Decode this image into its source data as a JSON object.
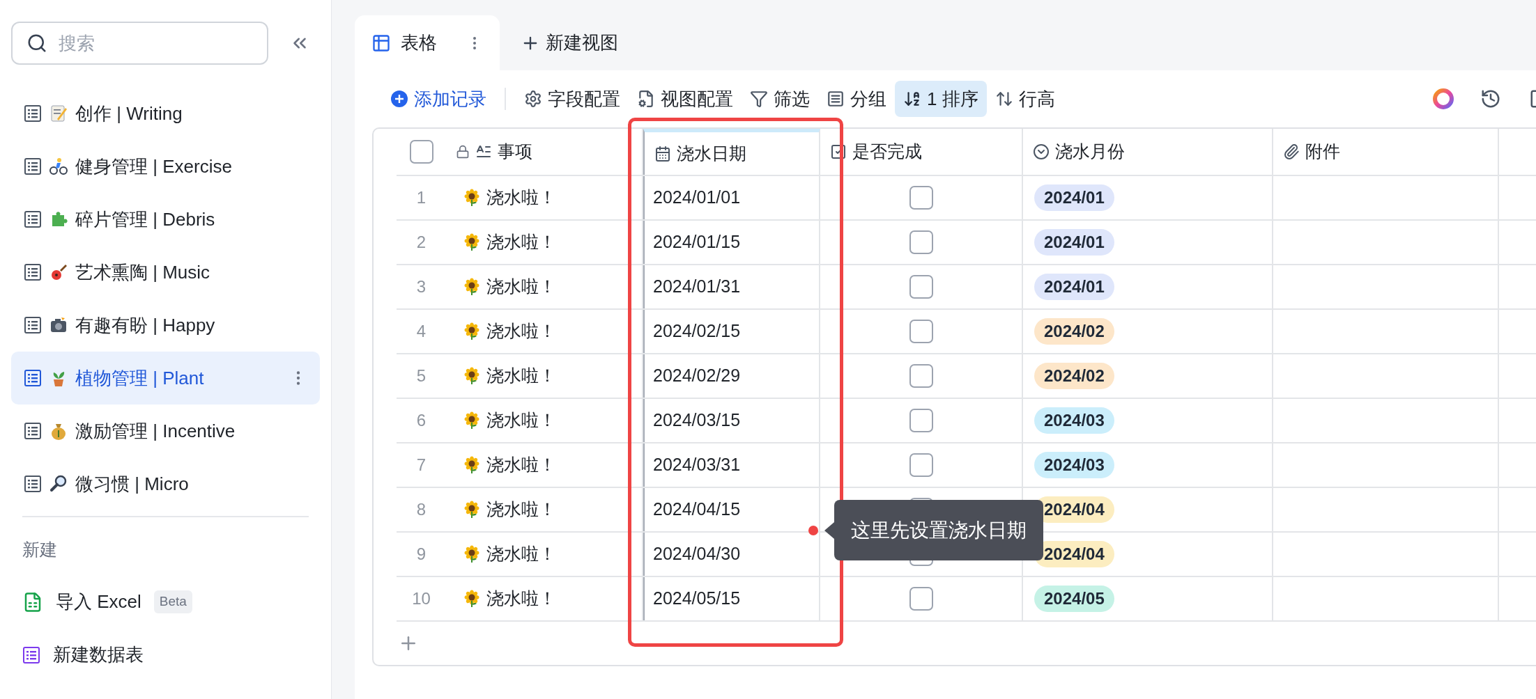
{
  "sidebar": {
    "search": {
      "placeholder": "搜索"
    },
    "items": [
      {
        "label": "创作 | Writing",
        "selected": false
      },
      {
        "label": "健身管理 | Exercise",
        "selected": false
      },
      {
        "label": "碎片管理 | Debris",
        "selected": false
      },
      {
        "label": "艺术熏陶 | Music",
        "selected": false
      },
      {
        "label": "有趣有盼 | Happy",
        "selected": false
      },
      {
        "label": "植物管理 | Plant",
        "selected": true
      },
      {
        "label": "激励管理 | Incentive",
        "selected": false
      },
      {
        "label": "微习惯 | Micro",
        "selected": false
      }
    ],
    "section_title": "新建",
    "create_items": [
      {
        "kind": "import",
        "label": "导入 Excel",
        "badge": "Beta"
      },
      {
        "kind": "table",
        "label": "新建数据表"
      }
    ]
  },
  "view_tabs": [
    {
      "label": "表格",
      "selected": true
    }
  ],
  "new_view_button": "新建视图",
  "toolbar": [
    {
      "kind": "add",
      "label": "添加记录",
      "selected": false
    },
    {
      "kind": "fields",
      "label": "字段配置",
      "selected": false
    },
    {
      "kind": "view",
      "label": "视图配置",
      "selected": false
    },
    {
      "kind": "filter",
      "label": "筛选",
      "selected": false
    },
    {
      "kind": "group",
      "label": "分组",
      "selected": false
    },
    {
      "kind": "sort",
      "label": "1 排序",
      "selected": true
    },
    {
      "kind": "row_height",
      "label": "行高",
      "selected": false
    }
  ],
  "table": {
    "select_all": false,
    "columns": [
      {
        "label": "事项",
        "kind": "primary",
        "selected": false
      },
      {
        "label": "浇水日期",
        "kind": "date",
        "selected": true
      },
      {
        "label": "是否完成",
        "kind": "checkbox",
        "selected": false
      },
      {
        "label": "浇水月份",
        "kind": "select",
        "selected": false
      },
      {
        "label": "附件",
        "kind": "attachment",
        "selected": false
      }
    ],
    "rows": [
      {
        "number": "1",
        "title": "浇水啦！",
        "date": "2024/01/01",
        "done": false,
        "month": {
          "label": "2024/01",
          "color": "#dfe6fb"
        }
      },
      {
        "number": "2",
        "title": "浇水啦！",
        "date": "2024/01/15",
        "done": false,
        "month": {
          "label": "2024/01",
          "color": "#dfe6fb"
        }
      },
      {
        "number": "3",
        "title": "浇水啦！",
        "date": "2024/01/31",
        "done": false,
        "month": {
          "label": "2024/01",
          "color": "#dfe6fb"
        }
      },
      {
        "number": "4",
        "title": "浇水啦！",
        "date": "2024/02/15",
        "done": false,
        "month": {
          "label": "2024/02",
          "color": "#fde6c9"
        }
      },
      {
        "number": "5",
        "title": "浇水啦！",
        "date": "2024/02/29",
        "done": false,
        "month": {
          "label": "2024/02",
          "color": "#fde6c9"
        }
      },
      {
        "number": "6",
        "title": "浇水啦！",
        "date": "2024/03/15",
        "done": false,
        "month": {
          "label": "2024/03",
          "color": "#cbeefb"
        }
      },
      {
        "number": "7",
        "title": "浇水啦！",
        "date": "2024/03/31",
        "done": false,
        "month": {
          "label": "2024/03",
          "color": "#cbeefb"
        }
      },
      {
        "number": "8",
        "title": "浇水啦！",
        "date": "2024/04/15",
        "done": false,
        "month": {
          "label": "2024/04",
          "color": "#fcedc0"
        }
      },
      {
        "number": "9",
        "title": "浇水啦！",
        "date": "2024/04/30",
        "done": false,
        "month": {
          "label": "2024/04",
          "color": "#fcedc0"
        }
      },
      {
        "number": "10",
        "title": "浇水啦！",
        "date": "2024/05/15",
        "done": false,
        "month": {
          "label": "2024/05",
          "color": "#c5f2e6"
        }
      }
    ]
  },
  "annotation": {
    "text": "这里先设置浇水日期"
  }
}
